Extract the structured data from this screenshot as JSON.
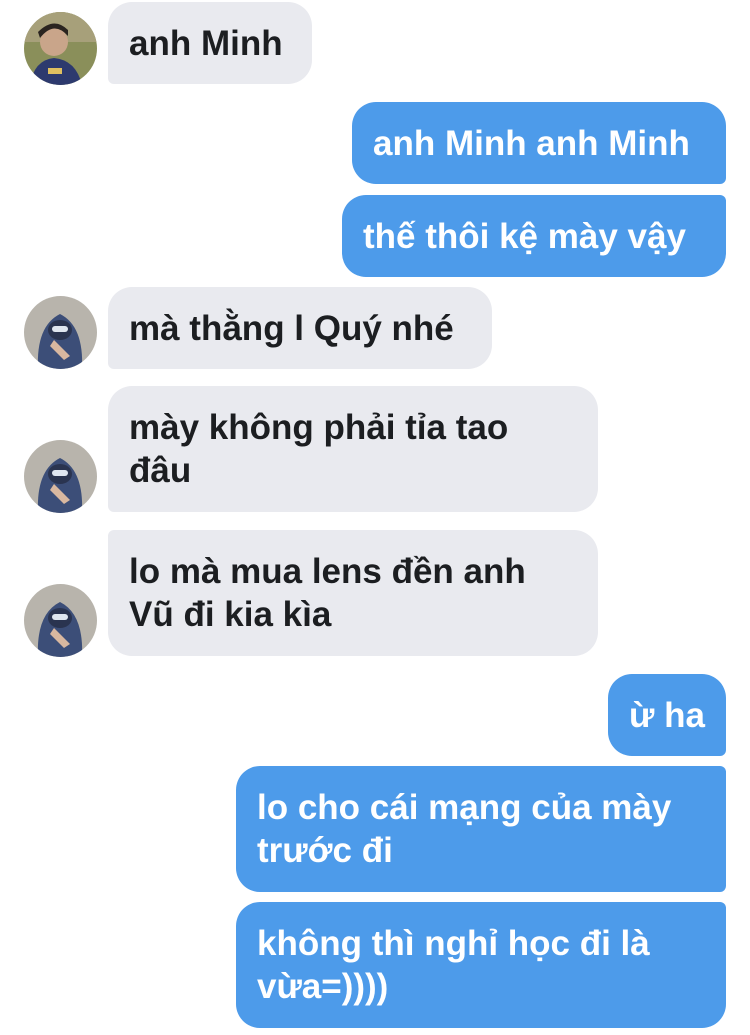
{
  "conversation": {
    "messages": [
      {
        "side": "incoming",
        "text": "anh Minh"
      },
      {
        "side": "outgoing",
        "text": "anh Minh anh Minh"
      },
      {
        "side": "outgoing",
        "text": "thế thôi kệ mày vậy"
      },
      {
        "side": "incoming",
        "text": "mà thằng l Quý nhé"
      },
      {
        "side": "incoming",
        "lines": [
          "mày không phải tỉa tao",
          "đâu"
        ]
      },
      {
        "side": "incoming",
        "lines": [
          "lo mà mua lens đền anh",
          "Vũ đi kia kìa"
        ]
      },
      {
        "side": "outgoing",
        "text": "ừ ha"
      },
      {
        "side": "outgoing",
        "lines": [
          "lo cho cái mạng của mày",
          "trước đi"
        ]
      },
      {
        "side": "outgoing",
        "lines": [
          "không thì nghỉ học đi là",
          "vừa=))))"
        ]
      }
    ]
  },
  "colors": {
    "incoming_bubble": "#e9eaef",
    "outgoing_bubble": "#4d9bea",
    "incoming_text": "#1c1e21",
    "outgoing_text": "#ffffff"
  },
  "avatars": {
    "contact_1": "person-avatar-photo",
    "contact_2": "hooded-person-avatar-photo"
  }
}
